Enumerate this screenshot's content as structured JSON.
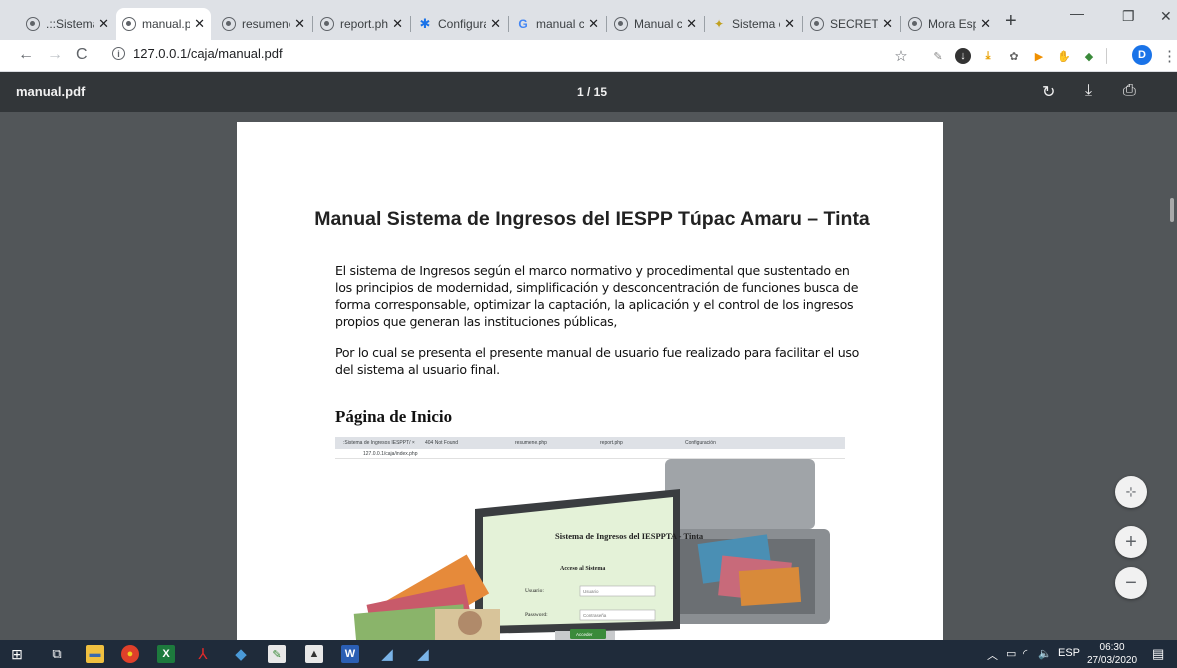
{
  "browser": {
    "tabs": [
      {
        "label": ".::Sistema",
        "icon": "globe-icon"
      },
      {
        "label": "manual.p",
        "icon": "globe-icon",
        "active": true
      },
      {
        "label": "resumene",
        "icon": "globe-icon"
      },
      {
        "label": "report.ph",
        "icon": "globe-icon"
      },
      {
        "label": "Configura",
        "icon": "gear-icon"
      },
      {
        "label": "manual c",
        "icon": "google-icon"
      },
      {
        "label": "Manual c",
        "icon": "globe-icon"
      },
      {
        "label": "Sistema c",
        "icon": "money-icon"
      },
      {
        "label": "SECRETA",
        "icon": "globe-icon"
      },
      {
        "label": "Mora Esp",
        "icon": "globe-icon"
      }
    ],
    "new_tab": "+",
    "url": "127.0.0.1/caja/manual.pdf",
    "avatar_letter": "D"
  },
  "pdf": {
    "filename": "manual.pdf",
    "page_indicator": "1 / 15",
    "title": "Manual Sistema de Ingresos del IESPP Túpac Amaru – Tinta",
    "paragraph1": "El sistema de Ingresos según el marco normativo y procedimental que sustentado en los principios de modernidad, simplificación y desconcentración de funciones busca de forma corresponsable, optimizar la captación, la aplicación y el control de los ingresos propios que generan las instituciones públicas,",
    "paragraph2": "Por lo cual se presenta el presente manual de usuario fue realizado para facilitar el uso del sistema al usuario final.",
    "heading": "Página de Inicio",
    "screenshot": {
      "tabs": [
        ":Sistema de Ingresos IESPPT/ ×",
        "404 Not Found",
        "resumene.php",
        "report.php",
        "Configuración"
      ],
      "url": "127.0.0.1/caja/index.php",
      "login_title": "Sistema de Ingresos del IESPPTA - Tinta",
      "login_subtitle": "Acceso al Sistema",
      "user_label": "Usuario:",
      "user_placeholder": "Usuario",
      "pass_label": "Password:",
      "pass_placeholder": "Contraseña",
      "submit": "Acceder"
    }
  },
  "taskbar": {
    "language": "ESP",
    "time": "06:30",
    "date": "27/03/2020"
  }
}
